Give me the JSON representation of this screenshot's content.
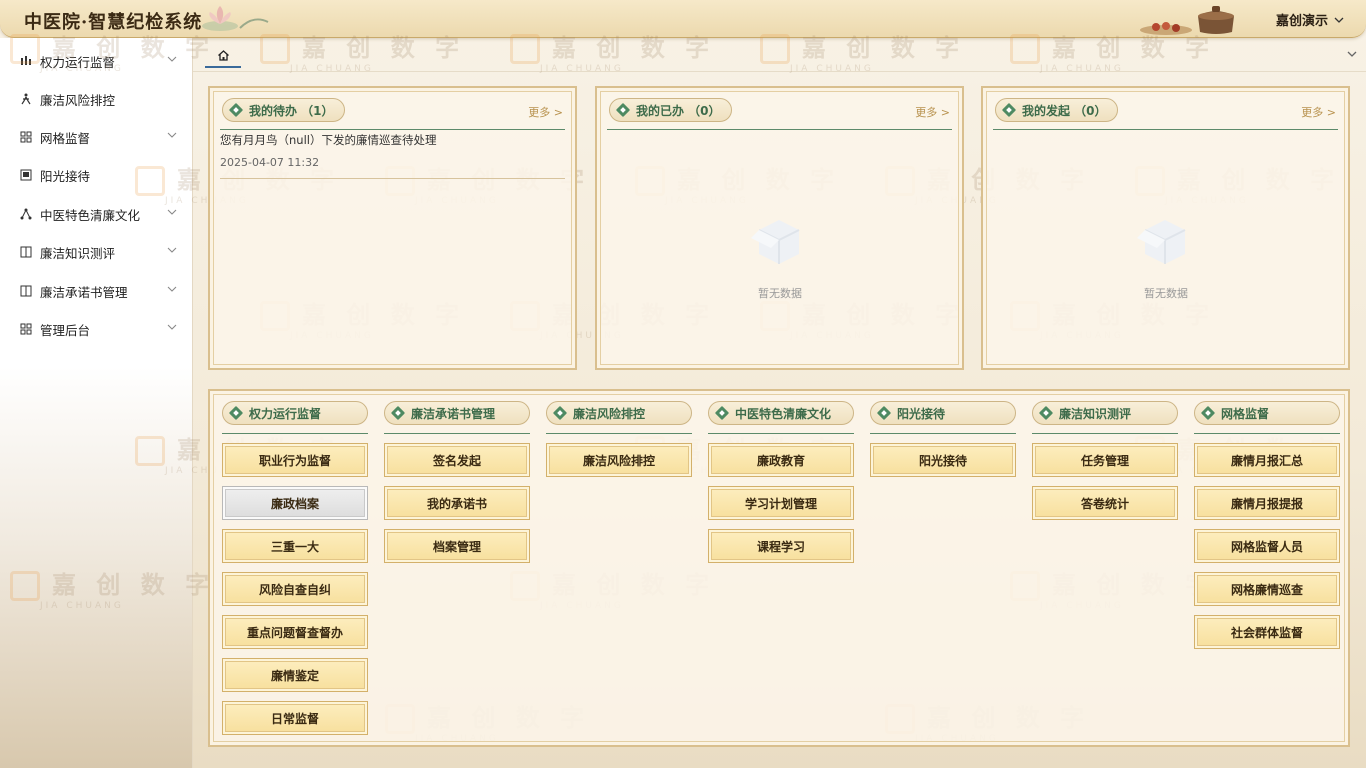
{
  "app": {
    "title": "中医院·智慧纪检系统",
    "user": "嘉创演示"
  },
  "sidebar": {
    "items": [
      {
        "label": "权力运行监督",
        "icon": "chart-bars-icon",
        "has_children": true
      },
      {
        "label": "廉洁风险排控",
        "icon": "person-run-icon",
        "has_children": false
      },
      {
        "label": "网格监督",
        "icon": "grid-icon",
        "has_children": true
      },
      {
        "label": "阳光接待",
        "icon": "monitor-icon",
        "has_children": false
      },
      {
        "label": "中医特色清廉文化",
        "icon": "share-nodes-icon",
        "has_children": true
      },
      {
        "label": "廉洁知识测评",
        "icon": "book-icon",
        "has_children": true
      },
      {
        "label": "廉洁承诺书管理",
        "icon": "book-icon",
        "has_children": true
      },
      {
        "label": "管理后台",
        "icon": "grid-icon",
        "has_children": true
      }
    ]
  },
  "tabs": {
    "home_icon": "home-icon"
  },
  "watermark": {
    "text": "嘉 创 数 字",
    "sub": "JIA CHUANG"
  },
  "panels": {
    "todo": {
      "title": "我的待办 （1）",
      "more": "更多 >",
      "items": [
        {
          "title": "您有月月鸟（null）下发的廉情巡查待处理",
          "time": "2025-04-07 11:32"
        }
      ]
    },
    "done": {
      "title": "我的已办 （0）",
      "more": "更多 >",
      "empty": "暂无数据"
    },
    "initiated": {
      "title": "我的发起 （0）",
      "more": "更多 >",
      "empty": "暂无数据"
    }
  },
  "modules": [
    {
      "title": "权力运行监督",
      "buttons": [
        "职业行为监督",
        "廉政档案",
        "三重一大",
        "风险自查自纠",
        "重点问题督查督办",
        "廉情鉴定",
        "日常监督"
      ],
      "highlight_index": 1
    },
    {
      "title": "廉洁承诺书管理",
      "buttons": [
        "签名发起",
        "我的承诺书",
        "档案管理"
      ]
    },
    {
      "title": "廉洁风险排控",
      "buttons": [
        "廉洁风险排控"
      ]
    },
    {
      "title": "中医特色清廉文化",
      "buttons": [
        "廉政教育",
        "学习计划管理",
        "课程学习"
      ]
    },
    {
      "title": "阳光接待",
      "buttons": [
        "阳光接待"
      ]
    },
    {
      "title": "廉洁知识测评",
      "buttons": [
        "任务管理",
        "答卷统计"
      ]
    },
    {
      "title": "网格监督",
      "buttons": [
        "廉情月报汇总",
        "廉情月报提报",
        "网格监督人员",
        "网格廉情巡查",
        "社会群体监督"
      ]
    }
  ],
  "colors": {
    "accent_green": "#4e8a62",
    "gold": "#d3b06a",
    "more_link": "#b8924e"
  }
}
